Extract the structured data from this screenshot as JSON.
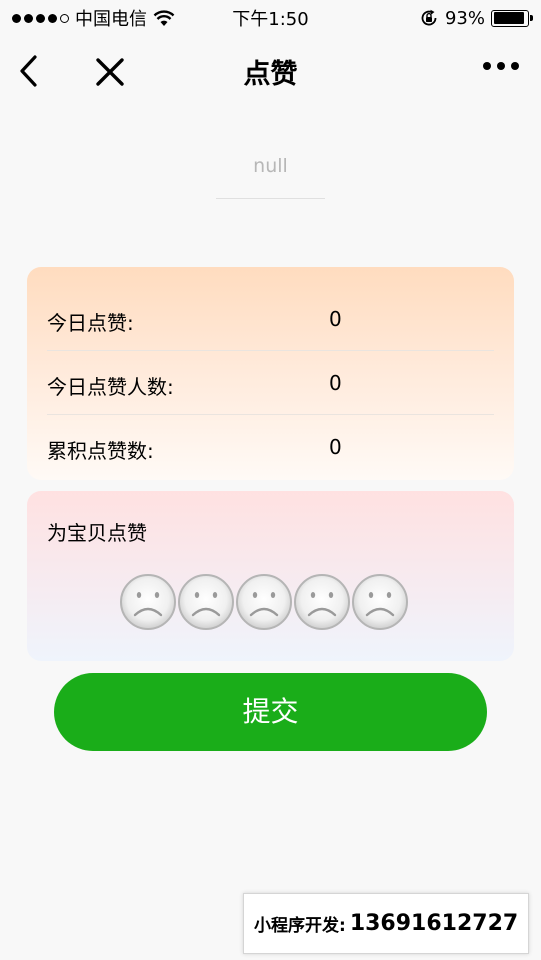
{
  "status_bar": {
    "carrier": "中国电信",
    "time": "下午1:50",
    "battery_percent": "93%",
    "battery_level": 0.93
  },
  "nav": {
    "title": "点赞"
  },
  "profile": {
    "name": "null"
  },
  "stats": [
    {
      "label": "今日点赞:",
      "value": "0"
    },
    {
      "label": "今日点赞人数:",
      "value": "0"
    },
    {
      "label": "累积点赞数:",
      "value": "0"
    }
  ],
  "rating": {
    "title": "为宝贝点赞",
    "faces": [
      "sad",
      "sad",
      "sad",
      "sad",
      "sad"
    ]
  },
  "submit_label": "提交",
  "ad": {
    "label": "小程序开发:",
    "phone": "13691612727"
  },
  "colors": {
    "primary_green": "#1aad19",
    "stats_card_top": "#ffdcbf",
    "rate_card_top": "#ffe1e1"
  }
}
